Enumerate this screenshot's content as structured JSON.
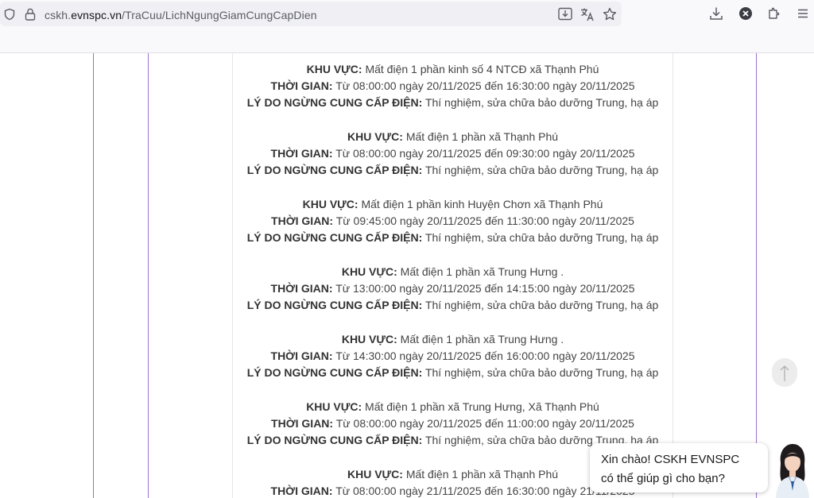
{
  "browser": {
    "url_prefix": "cskh.",
    "url_domain": "evnspc.vn",
    "url_path": "/TraCuu/LichNgungGiamCungCapDien",
    "icons": [
      "shield-icon",
      "lock-icon",
      "download-page-icon",
      "translate-icon",
      "bookmark-star-icon",
      "downloads-icon",
      "close-circle-icon",
      "extensions-icon",
      "menu-icon"
    ]
  },
  "labels": {
    "area": "KHU VỰC:",
    "time": "THỜI GIAN:",
    "reason": "LÝ DO NGỪNG CUNG CẤP ĐIỆN:"
  },
  "entries": [
    {
      "area": "Mất điện 1 phần kinh số 4 NTCĐ xã Thạnh Phú",
      "time": "Từ 08:00:00 ngày 20/11/2025 đến 16:30:00 ngày 20/11/2025",
      "reason": "Thí nghiệm, sửa chữa bảo dưỡng Trung, hạ áp"
    },
    {
      "area": "Mất điện 1 phần xã Thạnh Phú",
      "time": "Từ 08:00:00 ngày 20/11/2025 đến 09:30:00 ngày 20/11/2025",
      "reason": "Thí nghiệm, sửa chữa bảo dưỡng Trung, hạ áp"
    },
    {
      "area": "Mất điện 1 phần kinh Huyện Chơn xã Thạnh Phú",
      "time": "Từ 09:45:00 ngày 20/11/2025 đến 11:30:00 ngày 20/11/2025",
      "reason": "Thí nghiệm, sửa chữa bảo dưỡng Trung, hạ áp"
    },
    {
      "area": "Mất điện 1 phần xã Trung Hưng .",
      "time": "Từ 13:00:00 ngày 20/11/2025 đến 14:15:00 ngày 20/11/2025",
      "reason": "Thí nghiệm, sửa chữa bảo dưỡng Trung, hạ áp"
    },
    {
      "area": "Mất điện 1 phần xã Trung Hưng .",
      "time": "Từ 14:30:00 ngày 20/11/2025 đến 16:00:00 ngày 20/11/2025",
      "reason": "Thí nghiệm, sửa chữa bảo dưỡng Trung, hạ áp"
    },
    {
      "area": "Mất điện 1 phần xã Trung Hưng, Xã Thạnh Phú",
      "time": "Từ 08:00:00 ngày 20/11/2025 đến 11:00:00 ngày 20/11/2025",
      "reason": "Thí nghiệm, sửa chữa bảo dưỡng Trung, hạ áp"
    },
    {
      "area": "Mất điện 1 phần xã Thạnh Phú",
      "time": "Từ 08:00:00 ngày 21/11/2025 đến 16:30:00 ngày 21/11/2025",
      "reason": ""
    }
  ],
  "chat": {
    "line1": "Xin chào! CSKH EVNSPC",
    "line2": "có thể giúp gì cho bạn?"
  },
  "colors": {
    "purple_guide": "#9b72c8",
    "scroll_top_bg": "#ececec"
  }
}
